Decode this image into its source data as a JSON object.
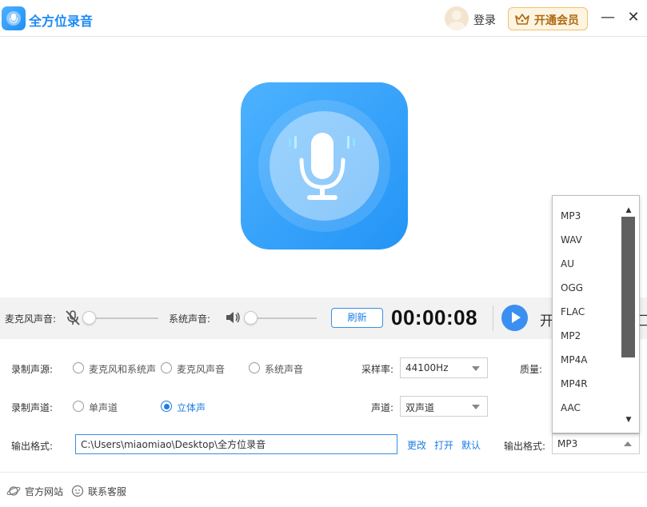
{
  "app": {
    "title": "全方位录音",
    "login": "登录",
    "vip": "开通会员",
    "minimize": "—",
    "close": "✕"
  },
  "controls": {
    "mic_label": "麦克风声音:",
    "system_label": "系统声音:",
    "mic_level": 0,
    "system_level": 0,
    "refresh": "刷新",
    "timer": "00:00:08",
    "start": "开",
    "stop": "匚"
  },
  "settings": {
    "source_label": "录制声源:",
    "source_options": [
      "麦克风和系统声",
      "麦克风声音",
      "系统声音"
    ],
    "sample_rate_label": "采样率:",
    "sample_rate_value": "44100Hz",
    "quality_label": "质量:",
    "channel_label": "录制声道:",
    "channel_options": [
      "单声道",
      "立体声"
    ],
    "channel_selected": "立体声",
    "channels_label": "声道:",
    "channels_value": "双声道",
    "output_label": "输出格式:",
    "output_path": "C:\\Users\\miaomiao\\Desktop\\全方位录音",
    "change": "更改",
    "open": "打开",
    "default": "默认",
    "format_label": "输出格式:",
    "format_value": "MP3",
    "format_options": [
      "MP3",
      "WAV",
      "AU",
      "OGG",
      "FLAC",
      "MP2",
      "MP4A",
      "MP4R",
      "AAC"
    ]
  },
  "footer": {
    "website": "官方网站",
    "support": "联系客服"
  },
  "colors": {
    "accent": "#1c7de6",
    "vip": "#b06a10",
    "logo_start": "#4db2ff",
    "logo_end": "#2394f6"
  }
}
